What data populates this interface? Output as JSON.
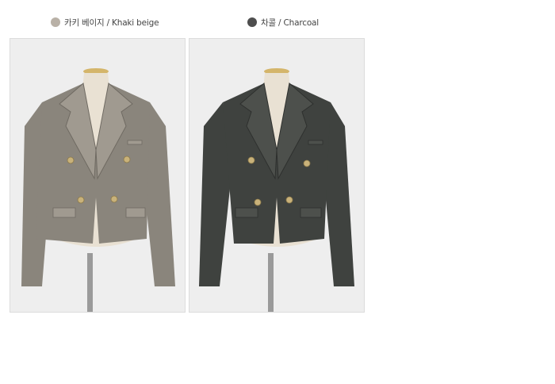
{
  "variants": [
    {
      "label": "카키 베이지 / Khaki beige",
      "swatch": "#b9b1a7",
      "jacket_color": "#8a857c",
      "jacket_shade": "#6f6a62",
      "jacket_light": "#a09a90"
    },
    {
      "label": "차콜 / Charcoal",
      "swatch": "#4e4e4e",
      "jacket_color": "#3f423f",
      "jacket_shade": "#2e302e",
      "jacket_light": "#4d504c"
    }
  ],
  "colors": {
    "background": "#ffffff",
    "panel_bg": "#eeeeee",
    "panel_border": "#dcdcdc",
    "mannequin": "#e9e1d3",
    "button_gold": "#c9b27a"
  }
}
